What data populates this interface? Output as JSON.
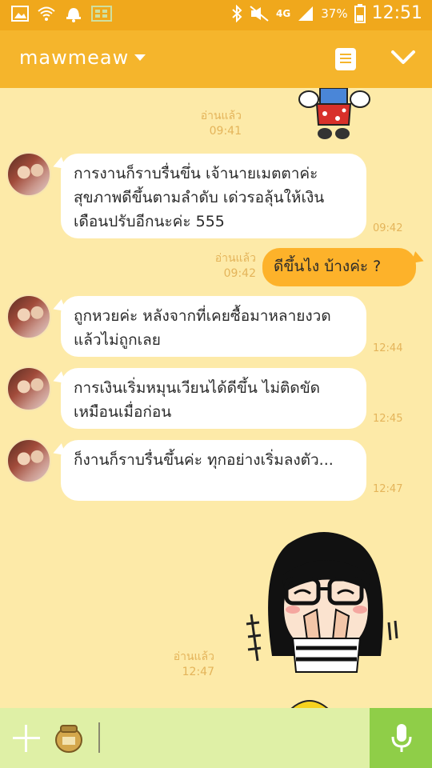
{
  "status_bar": {
    "network": "4G",
    "battery": "37%",
    "time": "12:51"
  },
  "header": {
    "title": "mawmeaw"
  },
  "messages": [
    {
      "kind": "read_receipt",
      "read_label": "อ่านแล้ว",
      "time": "09:41"
    },
    {
      "kind": "incoming",
      "text": "การงานก็ราบรื่นขึ่น เจ้านายเมตตาค่ะ สุขภาพดีขึ้นตามลำดับ เด่วรอลุ้นให้เงินเดือนปรับอีกนะค่ะ 555",
      "time": "09:42"
    },
    {
      "kind": "outgoing",
      "text": "ดีขึ้นไง บ้างค่ะ ?",
      "read_label": "อ่านแล้ว",
      "time": "09:42"
    },
    {
      "kind": "incoming",
      "text": "ถูกหวยค่ะ หลังจากที่เคยซื้อมาหลายงวดแล้วไม่ถูกเลย",
      "time": "12:44"
    },
    {
      "kind": "incoming",
      "text": "การเงินเริ่มหมุนเวียนได้ดีขึ้น ไม่ติดขัดเหมือนเมื่อก่อน",
      "time": "12:45"
    },
    {
      "kind": "incoming",
      "text": "ก็งานก็ราบรื่นขึ้นค่ะ ทุกอย่างเริ่มลงตัว...",
      "time": "12:47"
    },
    {
      "kind": "sticker_receipt",
      "read_label": "อ่านแล้ว",
      "time": "12:47"
    }
  ],
  "input": {
    "placeholder": ""
  },
  "icons": {
    "gallery": "image-icon",
    "wifi": "wifi-icon",
    "notification": "bell-icon",
    "bluetooth": "bluetooth-icon",
    "mute": "mute-icon",
    "signal": "signal-icon",
    "battery": "battery-icon",
    "memo": "note-icon",
    "collapse": "chevron-down-icon",
    "add": "plus-icon",
    "sticker": "sticker-jar-icon",
    "mic": "microphone-icon"
  },
  "colors": {
    "header": "#f5b52c",
    "status_bar": "#f0a81c",
    "chat_bg": "#fdeaa8",
    "outgoing_bubble": "#fdb22a",
    "mic_button": "#8fce48"
  }
}
